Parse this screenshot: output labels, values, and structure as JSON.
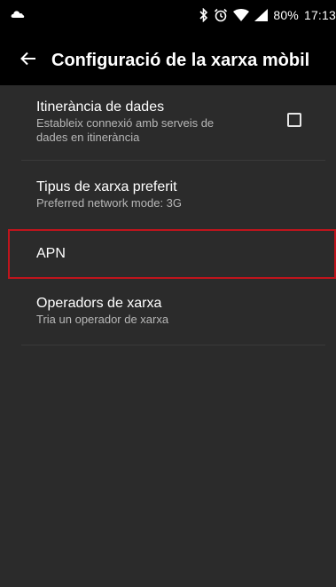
{
  "status_bar": {
    "battery": "80%",
    "time": "17:13",
    "icons": [
      "cloud-icon",
      "bluetooth-icon",
      "alarm-icon",
      "wifi-icon",
      "cell-signal-icon"
    ]
  },
  "app_bar": {
    "back_icon": "arrow-left-icon",
    "title": "Configuració de la xarxa mòbil"
  },
  "preferences": {
    "roaming": {
      "title": "Itinerància de dades",
      "summary_line1": "Estableix connexió amb serveis de",
      "summary_line2": "dades en itinerància",
      "checked": false
    },
    "network_type": {
      "title": "Tipus de xarxa preferit",
      "summary": "Preferred network mode: 3G"
    },
    "apn": {
      "title": "APN"
    },
    "operators": {
      "title": "Operadors de xarxa",
      "summary": "Tria un operador de xarxa"
    }
  },
  "colors": {
    "background": "#2b2b2b",
    "app_bar": "#000000",
    "highlight_border": "#c0141c"
  }
}
